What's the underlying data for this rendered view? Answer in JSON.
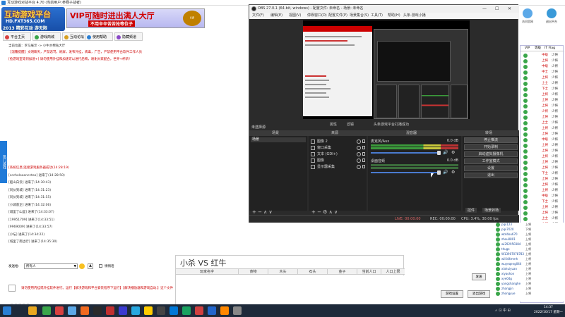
{
  "lobby": {
    "title": "互动游戏对战平台 4.70 (当前用户:参赛子战者)",
    "logo_main": "互动游戏平台",
    "logo_url": "HD.FXT365.COM",
    "logo_year": "2013 精彩互动 游无限",
    "ad_main": "VIP可随时进出满人大厅",
    "ad_sub": "不用辛辛苦苦抢等位子",
    "ad_badge": "VIP",
    "topright": [
      {
        "label": "访问官网"
      },
      {
        "label": "退出平台"
      }
    ],
    "tabs": [
      {
        "label": "平台主页",
        "color": "#d84040"
      },
      {
        "label": "游戏商城",
        "color": "#3aa64a"
      },
      {
        "label": "互动论坛",
        "color": "#d8a020"
      },
      {
        "label": "使用帮助",
        "color": "#2a7fd4"
      },
      {
        "label": "隐藏频道",
        "color": "#8a48c8"
      }
    ],
    "location": "当前位置：罗马展示 -> 小牛水棉钻大厅",
    "notice": "【温馨提醒】文明聊天，严禁恶骂，刷屏，发布外挂，病毒，广告，严禁使用平台软件工作人员",
    "notice2": "[抢游戏室等到加速+] 请勿使用外挂和加速可以进行后悔，谢谢大家配合，世界+杯新！",
    "side_label": "热门游戏",
    "chat_lines": [
      "[系统信息]连接游戏服务器成功(14:28:19)",
      "[cccheloooncctoo] 进来了(14:28:50)",
      "[超山白云] 进来了(14:30:43)",
      "[同伙到城] 进来了(14:31:23)",
      "[同伙到城] 进来了(14:31:55)",
      "[小城基正] 进来了(14:32:06)",
      "[城里了山里] 进来了(14:33:07)",
      "[19951709] 进来了(14:33:51)",
      "[9969009] 进来了(14:33:57)",
      "[小坛] 进来了(14:34:22)",
      "[城里了南边行] 进来了(14:35:30)"
    ],
    "chat_to_label": "发送给:",
    "chat_to_value": "所有人",
    "chat_dd": "▼",
    "chat_a": "A",
    "whisper_label": "悄悄话",
    "bottom_msg": "请勿使用内挂或外挂软件进行。运行【解决游戏和平台安装程序下运行】【解决播放器和游戏自动.】这个文件",
    "watermark": "00299",
    "send_label": "发送",
    "btn_settings": "游戏设置",
    "btn_exit": "退出游戏"
  },
  "vs": {
    "title": "小杀 VS 红牛",
    "columns": [
      "玩家名字",
      "食物",
      "木头",
      "石头",
      "金子",
      "当前人口",
      "人口上限"
    ]
  },
  "userlist": {
    "header": [
      "VIP",
      "等级",
      "IT Flag"
    ],
    "rows": [
      {
        "st": "中级",
        "st2": "少将"
      },
      {
        "st": "上将",
        "st2": "少将"
      },
      {
        "st": "中级",
        "st2": "少将"
      },
      {
        "st": "中士",
        "st2": "少将"
      },
      {
        "st": "上将",
        "st2": "少将"
      },
      {
        "st": "上士",
        "st2": "少将"
      },
      {
        "st": "下士",
        "st2": "少将"
      },
      {
        "st": "上将",
        "st2": "少将"
      },
      {
        "st": "上将",
        "st2": "少将"
      },
      {
        "st": "上将",
        "st2": "少将"
      },
      {
        "st": "少将",
        "st2": "少将"
      },
      {
        "st": "上将",
        "st2": "少将"
      },
      {
        "st": "上士",
        "st2": "少将"
      },
      {
        "st": "上将",
        "st2": "少将"
      },
      {
        "st": "上将",
        "st2": "少将"
      },
      {
        "st": "中级",
        "st2": "少将"
      },
      {
        "st": "上将",
        "st2": "少将"
      },
      {
        "st": "上将",
        "st2": "少将"
      },
      {
        "st": "上将",
        "st2": "少将"
      },
      {
        "st": "上将",
        "st2": "少将"
      },
      {
        "st": "上将",
        "st2": "少将"
      },
      {
        "st": "下士",
        "st2": "少将"
      },
      {
        "st": "上将",
        "st2": "少将"
      },
      {
        "st": "上将",
        "st2": "少将"
      },
      {
        "st": "上将",
        "st2": "少将"
      },
      {
        "st": "中级",
        "st2": "少将"
      },
      {
        "st": "下士",
        "st2": "少将"
      },
      {
        "st": "上将",
        "st2": "少将"
      },
      {
        "st": "上将",
        "st2": "少将"
      },
      {
        "st": "上士",
        "st2": "少将"
      },
      {
        "st": "上将",
        "st2": "少将"
      }
    ],
    "lower": [
      {
        "nm": "pipi123",
        "st": "上将"
      },
      {
        "nm": "pipi7020",
        "st": "下将"
      },
      {
        "nm": "wtd4ou670",
        "st": "上将"
      },
      {
        "nm": "zhou0801",
        "st": "上将"
      },
      {
        "nm": "wi292950384",
        "st": "上将"
      },
      {
        "nm": "thuge",
        "st": "上将"
      },
      {
        "nm": "W13907078783",
        "st": "上将"
      },
      {
        "nm": "willi44mmh",
        "st": "上将"
      },
      {
        "nm": "wuyeqeng044",
        "st": "上将"
      },
      {
        "nm": "xiahuiyuan",
        "st": "上将"
      },
      {
        "nm": "xiyaohon",
        "st": "上将"
      },
      {
        "nm": "xye04g",
        "st": "上将"
      },
      {
        "nm": "yangshanghe",
        "st": "上将"
      },
      {
        "nm": "zhangjin",
        "st": "上将"
      },
      {
        "nm": "zhongyue",
        "st": "上将"
      }
    ]
  },
  "obs": {
    "title": "OBS 27.0.1 (64-bit, windows) - 配置文件: 未命名 - 场景: 未命名",
    "menu": [
      "文件(F)",
      "编辑(E)",
      "视图(V)",
      "停靠窗口(D)",
      "配置文件(P)",
      "场景集合(S)",
      "工具(T)",
      "帮助(H)",
      "头条-游戏小播"
    ],
    "scene_tab_left": "未选择源",
    "scene_tab_mid1": "属性",
    "scene_tab_mid2": "滤镜",
    "scene_tab_right": "头条游戏平台打播成功",
    "docks": [
      "场景",
      "来源",
      "混音器",
      "转场"
    ],
    "scene_item": "场景",
    "sources": [
      {
        "name": "图像 2"
      },
      {
        "name": "窗口采集"
      },
      {
        "name": "文本 (GDI+)"
      },
      {
        "name": "图像"
      },
      {
        "name": "显示器采集"
      }
    ],
    "mixer": [
      {
        "name": "麦克风/Aux",
        "db": "0.0 dB"
      },
      {
        "name": "桌面音频",
        "db": "0.0 dB"
      }
    ],
    "controls": [
      "停止推流",
      "开始录制",
      "启动虚拟摄像机",
      "工作室模式",
      "设置",
      "退出"
    ],
    "ctrl_tab1": "控件",
    "ctrl_tab2": "场景转场",
    "status_live": "LIVE: 00:00:00",
    "status_rec": "REC: 00:00:00",
    "status_cpu": "CPU: 3.4%, 30.00 fps",
    "dock_btn_scenes": "+ − ∧ ∨",
    "dock_btn_sources": "+ − ⚙ ∧ ∨"
  },
  "taskbar": {
    "time": "14:37",
    "date": "2022/10/17 星期一",
    "sys": "ㅅ  ⊡  中  ⊞"
  },
  "colors": {
    "taskbar_icons": [
      "#2a7fd4",
      "#e8a820",
      "#3aa64a",
      "#d84040",
      "#5ca9e8",
      "#f06a20",
      "#2a2a2a",
      "#c03030",
      "#3a3ad0",
      "#28a8e0",
      "#ffcc00",
      "#444",
      "#0078d7",
      "#1aa260",
      "#d04040",
      "#2266cc",
      "#ff8800",
      "#888"
    ]
  }
}
